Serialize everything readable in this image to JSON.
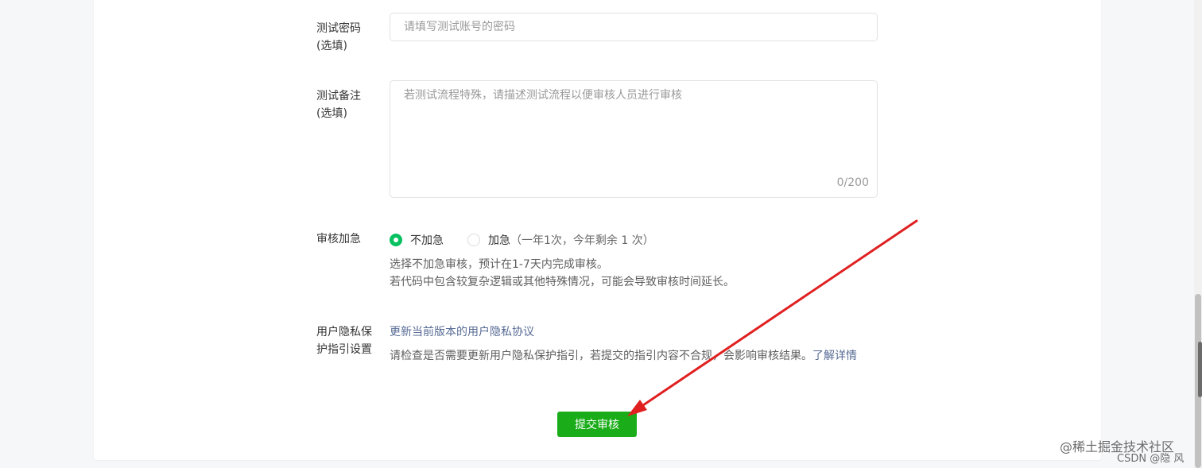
{
  "form": {
    "test_password_label": "测试密码",
    "test_password_optional": "(选填)",
    "test_password_placeholder": "请填写测试账号的密码",
    "test_note_label": "测试备注",
    "test_note_optional": "(选填)",
    "test_note_placeholder": "若测试流程特殊，请描述测试流程以便审核人员进行审核",
    "test_note_counter": "0/200",
    "urgency_label": "审核加急",
    "urgency_options": [
      {
        "label": "不加急",
        "sub": "",
        "checked": true
      },
      {
        "label": "加急",
        "sub": "（一年1次，今年剩余  1  次）",
        "checked": false
      }
    ],
    "urgency_hint_1": "选择不加急审核，预计在1-7天内完成审核。",
    "urgency_hint_2": "若代码中包含较复杂逻辑或其他特殊情况，可能会导致审核时间延长。",
    "privacy_label_1": "用户隐私保",
    "privacy_label_2": "护指引设置",
    "privacy_link": "更新当前版本的用户隐私协议",
    "privacy_hint": "请检查是否需要更新用户隐私保护指引，若提交的指引内容不合规，会影响审核结果。",
    "privacy_detail_link": "了解详情",
    "submit_label": "提交审核"
  },
  "watermark": {
    "line_1": "@稀土掘金技术社区",
    "line_2": "CSDN @隐 风"
  },
  "colors": {
    "accent_green": "#1aad19",
    "radio_green": "#07c160",
    "link_blue": "#576b95",
    "annotation_red": "#e02020"
  }
}
